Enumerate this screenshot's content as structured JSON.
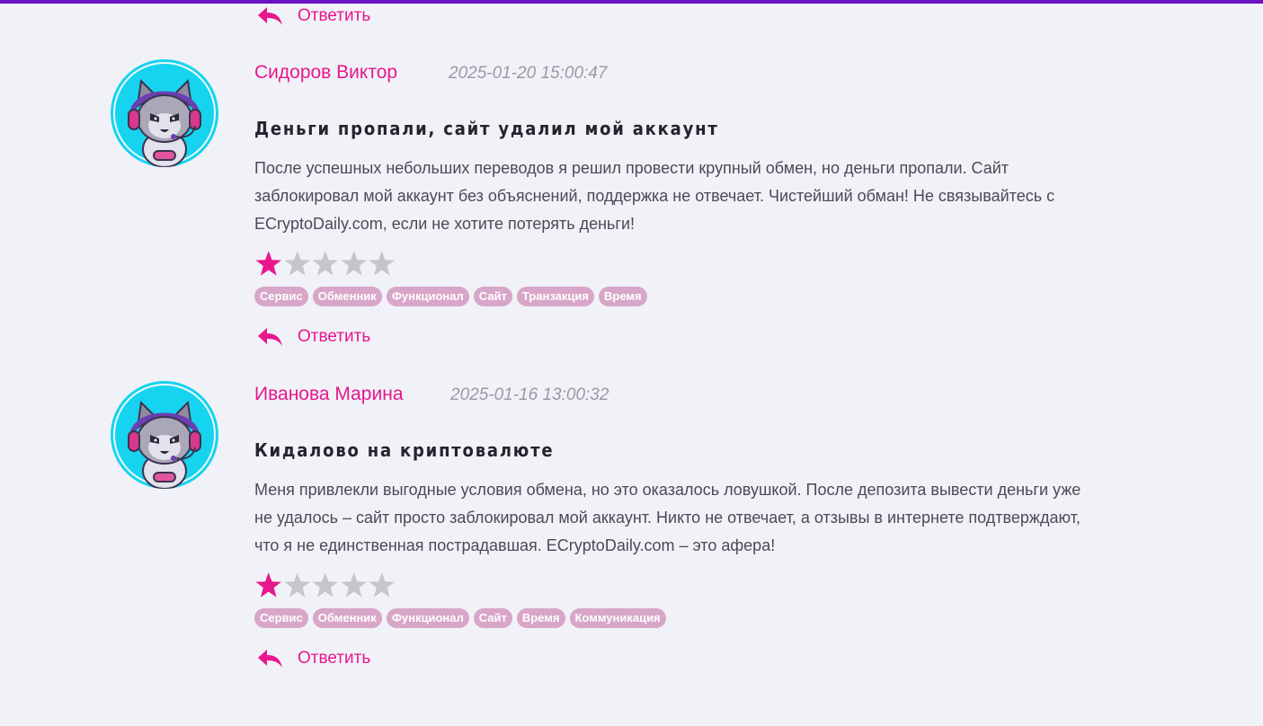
{
  "accent_color": "#e8178e",
  "tag_color": "#d8a6c8",
  "top_reply": {
    "label": "Ответить",
    "icon": "reply-arrow-icon"
  },
  "reviews": [
    {
      "author": "Сидоров Виктор",
      "date": "2025-01-20 15:00:47",
      "title": "Деньги пропали, сайт удалил мой аккаунт",
      "text": "После успешных небольших переводов я решил провести крупный обмен, но деньги пропали. Сайт заблокировал мой аккаунт без объяснений, поддержка не отвечает. Чистейший обман! Не связывайтесь с ECryptoDaily.com, если не хотите потерять деньги!",
      "rating": 1,
      "max_rating": 5,
      "avatar_icon": "cat-gamer-avatar-icon",
      "tags": [
        "Сервис",
        "Обменник",
        "Функционал",
        "Сайт",
        "Транзакция",
        "Время"
      ],
      "reply_label": "Ответить"
    },
    {
      "author": "Иванова Марина",
      "date": "2025-01-16 13:00:32",
      "title": "Кидалово на криптовалюте",
      "text": "Меня привлекли выгодные условия обмена, но это оказалось ловушкой. После депозита вывести деньги уже не удалось – сайт просто заблокировал мой аккаунт. Никто не отвечает, а отзывы в интернете подтверждают, что я не единственная пострадавшая. ECryptoDaily.com – это афера!",
      "rating": 1,
      "max_rating": 5,
      "avatar_icon": "cat-gamer-avatar-icon",
      "tags": [
        "Сервис",
        "Обменник",
        "Функционал",
        "Сайт",
        "Время",
        "Коммуникация"
      ],
      "reply_label": "Ответить"
    }
  ]
}
